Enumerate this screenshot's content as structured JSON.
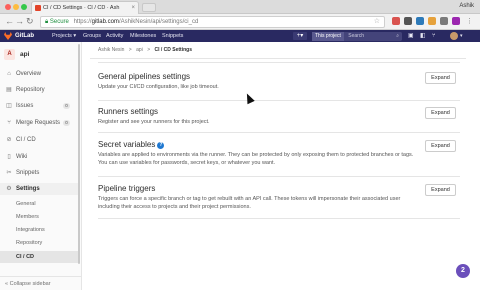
{
  "browser": {
    "tab_title": "CI / CD Settings · CI / CD · Ash",
    "tab_close": "×",
    "profile": "Ashik",
    "secure_label": "Secure",
    "url_scheme": "https://",
    "url_host": "gitlab.com",
    "url_path": "/AshikNesin/api/settings/ci_cd"
  },
  "gitlab_nav": {
    "brand": "GitLab",
    "links": [
      "Projects ▾",
      "Groups",
      "Activity",
      "Milestones",
      "Snippets"
    ],
    "search_scope": "This project",
    "search_placeholder": "Search",
    "plus_label": "+▾"
  },
  "sidebar": {
    "project_letter": "A",
    "project_name": "api",
    "items": [
      {
        "label": "Overview",
        "icon": "home-icon"
      },
      {
        "label": "Repository",
        "icon": "repository-icon"
      },
      {
        "label": "Issues",
        "icon": "issues-icon",
        "badge": "0"
      },
      {
        "label": "Merge Requests",
        "icon": "merge-request-icon",
        "badge": "0"
      },
      {
        "label": "CI / CD",
        "icon": "rocket-icon"
      },
      {
        "label": "Wiki",
        "icon": "book-icon"
      },
      {
        "label": "Snippets",
        "icon": "scissors-icon"
      },
      {
        "label": "Settings",
        "icon": "gear-icon"
      }
    ],
    "sub_items": [
      "General",
      "Members",
      "Integrations",
      "Repository",
      "CI / CD"
    ],
    "collapse_label": "Collapse sidebar"
  },
  "breadcrumb": {
    "items": [
      "Ashik Nesin",
      "api",
      "CI / CD Settings"
    ],
    "separator": ">"
  },
  "sections": [
    {
      "title": "General pipelines settings",
      "description": "Update your CI/CD configuration, like job timeout.",
      "button": "Expand"
    },
    {
      "title": "Runners settings",
      "description": "Register and see your runners for this project.",
      "button": "Expand"
    },
    {
      "title": "Secret variables",
      "description": "Variables are applied to environments via the runner. They can be protected by only exposing them to protected branches or tags. You can use variables for passwords, secret keys, or whatever you want.",
      "button": "Expand"
    },
    {
      "title": "Pipeline triggers",
      "description": "Triggers can force a specific branch or tag to get rebuilt with an API call. These tokens will impersonate their associated user including their access to projects and their project permissions.",
      "button": "Expand"
    }
  ],
  "help_badge": "2",
  "colors": {
    "navbar": "#292961",
    "accent": "#1f78d1",
    "help_bubble": "#6b4fbb"
  }
}
